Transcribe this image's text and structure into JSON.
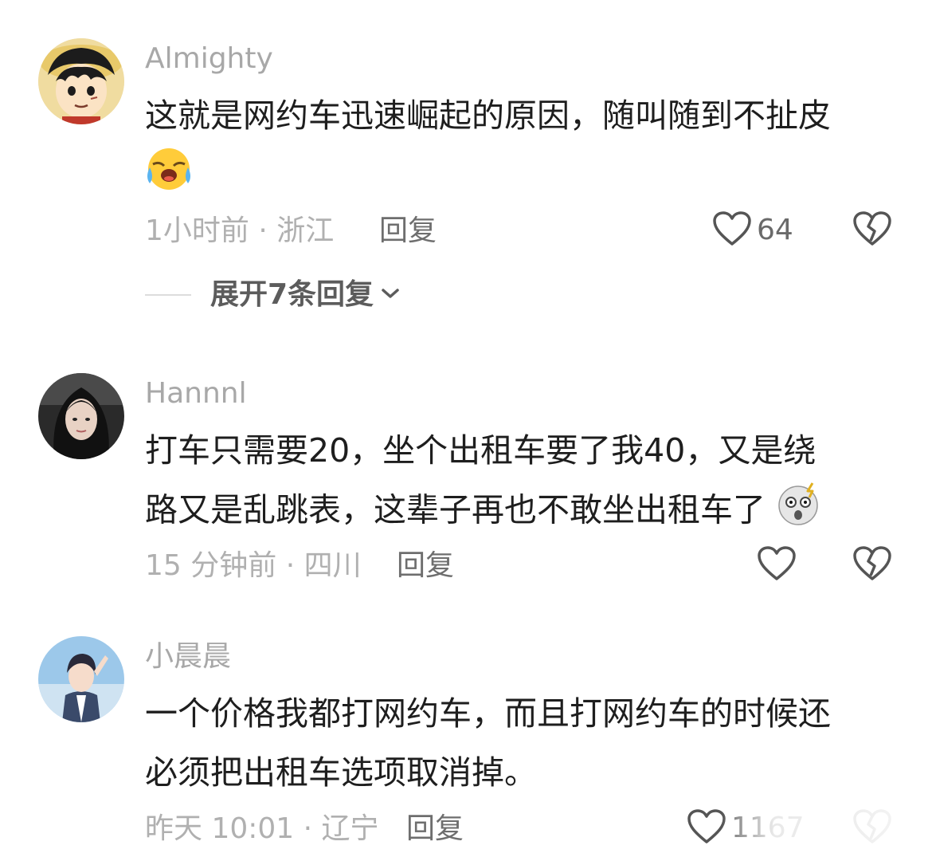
{
  "comments": [
    {
      "username": "Almighty",
      "lines": [
        "这就是网约车迅速崛起的原因，随叫随到不扯皮",
        ""
      ],
      "emoji": "crying-laugh-emoji",
      "time_location": "1小时前 · 浙江",
      "reply_label": "回复",
      "like_count": "64",
      "expand_label": "展开7条回复"
    },
    {
      "username": "Hannnl",
      "lines": [
        "打车只需要20，坐个出租车要了我40，又是绕",
        "路又是乱跳表，这辈子再也不敢坐出租车了"
      ],
      "emoji": "shocked-emoji",
      "time_location": "15 分钟前 · 四川",
      "reply_label": "回复",
      "like_count": ""
    },
    {
      "username": "小晨晨",
      "lines": [
        "一个价格我都打网约车，而且打网约车的时候还",
        "必须把出租车选项取消掉。"
      ],
      "time_location": "昨天 10:01 · 辽宁",
      "reply_label": "回复",
      "like_count": "1167"
    }
  ],
  "icons": {
    "like": "heart-outline-icon",
    "dislike": "broken-heart-icon",
    "expand": "chevron-down-icon"
  },
  "colors": {
    "background": "#ffffff",
    "text": "#1e1e1e",
    "muted": "#a8a8a8",
    "action": "#6e6e6e"
  }
}
